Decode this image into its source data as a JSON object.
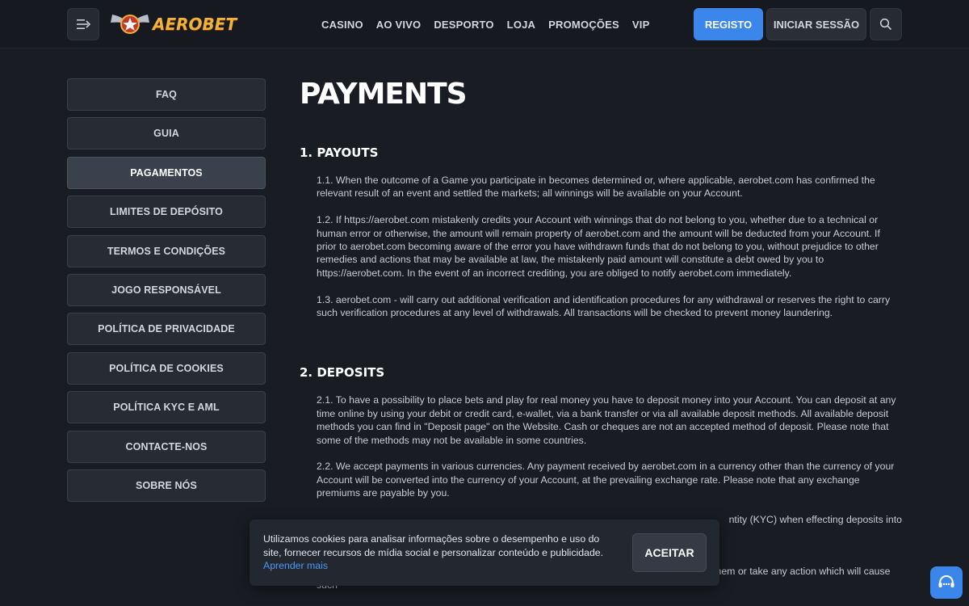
{
  "header": {
    "logo_text": "AEROBET",
    "nav": [
      "CASINO",
      "AO VIVO",
      "DESPORTO",
      "LOJA",
      "PROMOÇÕES",
      "VIP"
    ],
    "register_label": "REGISTO",
    "login_label": "INICIAR SESSÃO",
    "icons": {
      "menu": "menu-arrow-icon",
      "search": "search-icon"
    }
  },
  "sidebar": {
    "items": [
      {
        "label": "FAQ",
        "active": false
      },
      {
        "label": "GUIA",
        "active": false
      },
      {
        "label": "PAGAMENTOS",
        "active": true
      },
      {
        "label": "LIMITES DE DEPÓSITO",
        "active": false
      },
      {
        "label": "TERMOS E CONDIÇÕES",
        "active": false
      },
      {
        "label": "JOGO RESPONSÁVEL",
        "active": false
      },
      {
        "label": "POLÍTICA DE PRIVACIDADE",
        "active": false
      },
      {
        "label": "POLÍTICA DE COOKIES",
        "active": false
      },
      {
        "label": "POLÍTICA KYC E AML",
        "active": false
      },
      {
        "label": "CONTACTE-NOS",
        "active": false
      },
      {
        "label": "SOBRE NÓS",
        "active": false
      }
    ]
  },
  "main": {
    "title": "PAYMENTS",
    "sections": [
      {
        "heading": "1. PAYOUTS",
        "paragraphs": [
          "1.1. When the outcome of a Game you participate in becomes determined or, where applicable, aerobet.com has confirmed the relevant result of an event and settled the markets; all winnings will be available on your Account.",
          "1.2. If https://aerobet.com mistakenly credits your Account with winnings that do not belong to you, whether due to a technical or human error or otherwise, the amount will remain property of aerobet.com and the amount will be deducted from your Account. If prior to aerobet.com becoming aware of the error you have withdrawn funds that do not belong to you, without prejudice to other remedies and actions that may be available at law, the mistakenly paid amount will constitute a debt owed by you to https://aerobet.com. In the event of an incorrect crediting, you are obliged to notify aerobet.com immediately.",
          "1.3. aerobet.com - will carry out additional verification and identification procedures for any withdrawal or reserves the right to carry such verification procedures at any level of withdrawals. All transactions will be checked to prevent money laundering."
        ]
      },
      {
        "heading": "2. DEPOSITS",
        "paragraphs": [
          "2.1. To have a possibility to place bets and play for real money you have to deposit money into your Account. You can deposit at any time online by using your debit or credit card, e-wallet, via a bank transfer or via all available deposit methods. All available deposit methods you can find in \"Deposit page\" on the Website. Cash or cheques are not an accepted method of deposit. Please note that some of the methods may not be available in some countries.",
          "2.2. We accept payments in various currencies. Any payment received by aerobet.com in a currency other than the currency of your Account will be converted into the currency of your Account, at the prevailing exchange rate. Please note that any exchange premiums are payable by you.",
          "ntity (KYC) when effecting deposits into",
          "2.5. By depositing you confirm that all deposits are authorized and you won't try to decline them or take any action which will cause such"
        ]
      }
    ]
  },
  "cookie_banner": {
    "text": "Utilizamos cookies para analisar informações sobre o desempenho e uso do site, fornecer recursos de mídia social e personalizar conteúdo e publicidade.",
    "link": "Aprender mais",
    "accept_label": "ACEITAR"
  },
  "support": {
    "icon": "support-chat-icon"
  },
  "colors": {
    "accent": "#3a86ea",
    "background": "#191c22",
    "logo": "#f0b23a"
  }
}
